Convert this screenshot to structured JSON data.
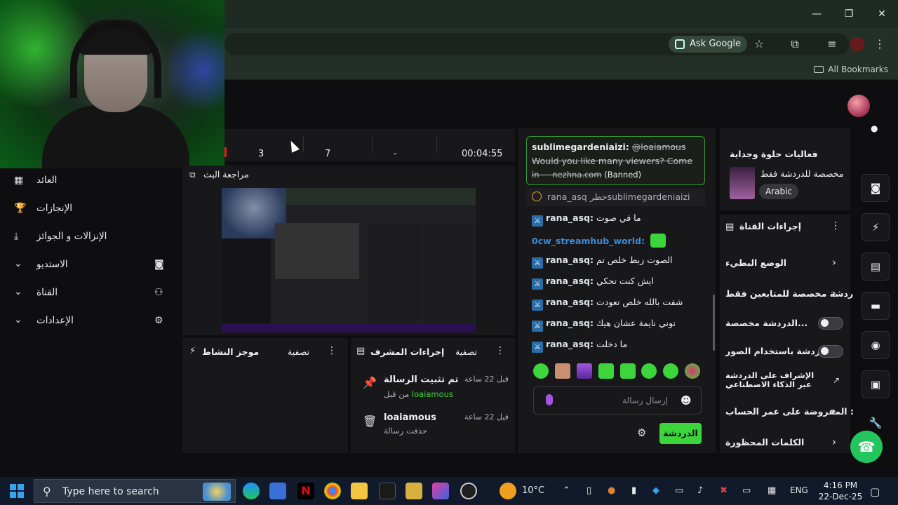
{
  "browser": {
    "ask_google": "Ask Google",
    "all_bookmarks": "All Bookmarks"
  },
  "stats": {
    "viewers": "3",
    "followers": "7",
    "dash": "-",
    "uptime": "00:04:55"
  },
  "left_nav": {
    "items": [
      {
        "label": "العائد"
      },
      {
        "label": "الإنجازات"
      },
      {
        "label": "الإنزالات و الجوائز"
      },
      {
        "label": "الاستديو"
      },
      {
        "label": "القناة"
      },
      {
        "label": "الإعدادات"
      }
    ]
  },
  "preview": {
    "title": "مراجعة البث"
  },
  "activity": {
    "title": "موجز النشاط",
    "filter": "تصفية"
  },
  "mod_actions": {
    "title": "إجراءات المشرف",
    "filter": "تصفية",
    "rows": [
      {
        "title": "تم تثبيت الرسالة",
        "sub_prefix": "من قبل",
        "user": "loaiamous",
        "time": "قبل 22 ساعة"
      },
      {
        "title": "loaiamous",
        "sub": "حذفت رسالة",
        "time": "قبل 22 ساعة"
      }
    ]
  },
  "chat": {
    "banned": {
      "user": "sublimegardeniaizi:",
      "mention": "@loaiamous",
      "text1": "Would you like many viewers? Come",
      "text2": "in — nezhna.com",
      "status": "(Banned)"
    },
    "ban_notice": {
      "user": "rana_asq",
      "verb": "حظر",
      "target": "sublimegardeniaizi"
    },
    "messages": [
      {
        "user": "rana_asq:",
        "text": "ما في صوت"
      },
      {
        "user": "0cw_streamhub_world:",
        "text": ""
      },
      {
        "user": "rana_asq:",
        "text": "الصوت زبط خلص تم"
      },
      {
        "user": "rana_asq:",
        "text": "ايش كنت تحكي"
      },
      {
        "user": "rana_asq:",
        "text": "شفت بالله خلص تعودت"
      },
      {
        "user": "rana_asq:",
        "text": "نوني نايمة عشان هيك"
      },
      {
        "user": "rana_asq:",
        "text": "ما دخلت"
      }
    ],
    "input_placeholder": "إرسال رسالة",
    "send_label": "الدردشة"
  },
  "right_panel": {
    "category_title": "فعاليات حلوة وجداية",
    "category_sub": "مخصصة للدردشة فقط",
    "language": "Arabic",
    "channel_actions": "إجراءات القناة",
    "items": [
      {
        "label": "الوضع البطيء",
        "control": "chevron"
      },
      {
        "label": "دردشة مخصصة للمتابعين فقط",
        "control": "chevron"
      },
      {
        "label": "الدردشة مخصصة...",
        "control": "toggle"
      },
      {
        "label": "الدردشة باستخدام الصور...",
        "control": "toggle"
      },
      {
        "label": "الإشراف على الدردشة عبر الذكاء الاصطناعي",
        "control": "external"
      },
      {
        "label": "المفروضة على عمر الحساب :",
        "control": "chevron"
      },
      {
        "label": "الكلمات المحظورة",
        "control": "chevron"
      }
    ]
  },
  "taskbar": {
    "search_placeholder": "Type here to search",
    "weather": "10°C",
    "lang": "ENG",
    "time": "4:16 PM",
    "date": "22-Dec-25"
  },
  "colors": {
    "accent_green": "#3cd63c",
    "panel_bg": "#18181b",
    "page_bg": "#0e0e10"
  }
}
